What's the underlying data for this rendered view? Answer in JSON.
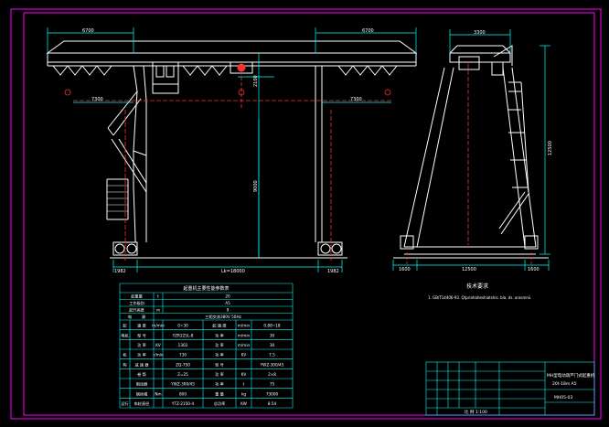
{
  "colors": {
    "background": "#000000",
    "frame": "#ff00ff",
    "structure": "#ffffff",
    "dimension": "#00ffff",
    "centerline": "#ff3030",
    "table": "#00ffff",
    "table_text": "#ffff66"
  },
  "front_view": {
    "dim_left_cantilever": "6700",
    "dim_right_cantilever": "6700",
    "dim_left_hook_approach": "7300",
    "dim_right_hook_approach": "7300",
    "dim_lift_height": "9000",
    "dim_beam_height": "2100",
    "dim_left_wheel": "1982",
    "dim_right_wheel": "1982",
    "dim_span": "Lk=18000"
  },
  "side_view": {
    "dim_top_width": "3300",
    "dim_total_height": "12500",
    "dim_left_base": "1600",
    "dim_base": "12500",
    "dim_right_base": "1600"
  },
  "tech_requirements": {
    "title": "技术要求",
    "body": "1. GB/T14406-93. Qtpriahaheshiatshis. bla. ds. arasmnii."
  },
  "spec_table": {
    "title": "起重机主要性能参数表",
    "rows_top": [
      [
        "起重量",
        "t",
        "20"
      ],
      [
        "工作级别",
        "",
        "A5"
      ],
      [
        "起升高度",
        "m",
        "9"
      ],
      [
        "电",
        "源",
        "三相交流380V 50Hz"
      ]
    ],
    "rows": [
      [
        "起",
        "速 度",
        "m/min",
        "0~30",
        "起 速 度",
        "m/min",
        "0.88~18"
      ],
      [
        "电机",
        "型 号",
        "",
        "YZR225L-8",
        "功 率",
        "m/min",
        "30"
      ],
      [
        "",
        "功 率",
        "KV",
        "1302",
        "功 率",
        "m/min",
        "30"
      ],
      [
        "机",
        "功 率",
        "r/min",
        "730",
        "功 率",
        "KV",
        "7.5"
      ],
      [
        "构",
        "减 速 器",
        "",
        "ZQ-750",
        "型 号",
        "",
        "YWZ-300/45"
      ],
      [
        "",
        "卷 筒",
        "",
        "Z=25",
        "功 率",
        "KV",
        "2×8"
      ],
      [
        "",
        "制动器",
        "",
        "YWZ-300/45",
        "功 率",
        "t",
        "75"
      ],
      [
        "",
        "钢丝绳",
        "Nm",
        "800",
        "重 量",
        "kg",
        "73000"
      ],
      [
        "运行",
        "车轮直径",
        "",
        "YTZ-2150-4",
        "总功率",
        "KW",
        "8.54"
      ]
    ]
  },
  "title_block": {
    "drawing_name": "MH型电动葫芦门式起重机",
    "drawing_spec": "20t-18m A5",
    "drawing_number": "MH05-03",
    "scale_row": "比 例 1:100"
  }
}
